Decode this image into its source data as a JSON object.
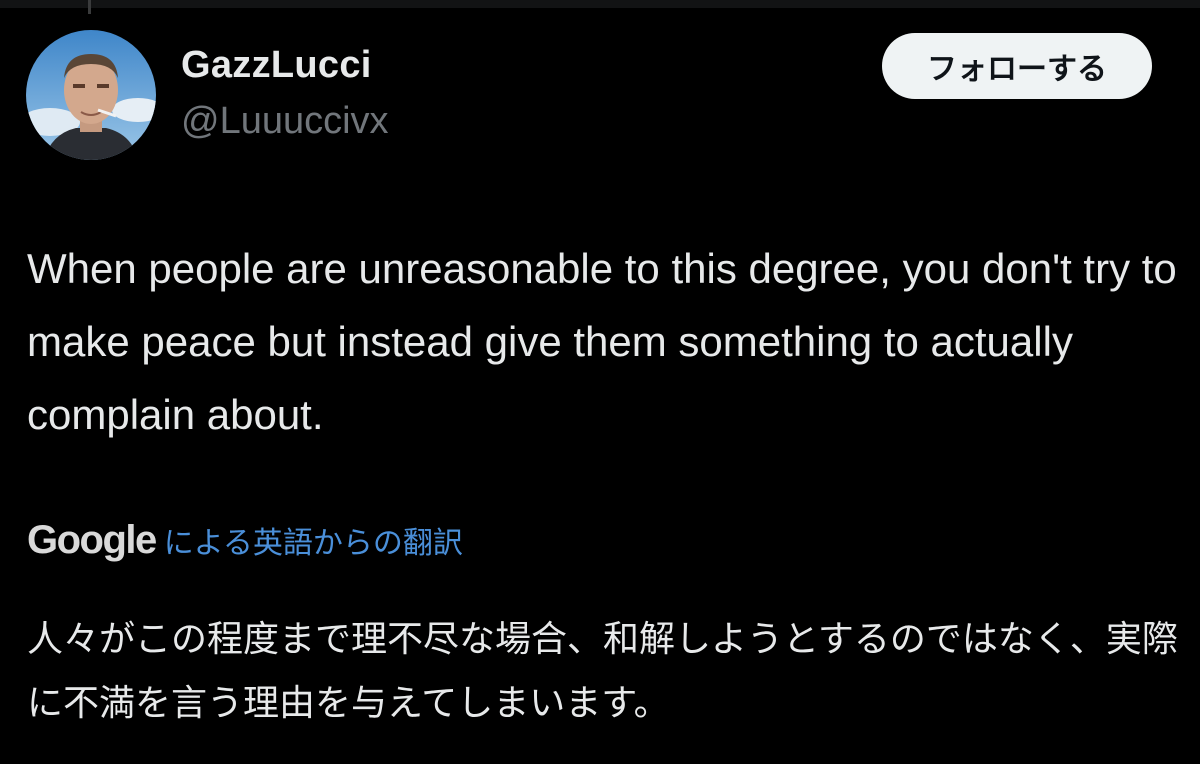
{
  "tweet": {
    "author": {
      "display_name": "GazzLucci",
      "handle": "@Luuuccivx"
    },
    "follow_label": "フォローする",
    "text": "When people are unreasonable to this degree, you don't try to make peace but instead give them something to actually complain about.",
    "translation": {
      "provider": "Google",
      "label": "による英語からの翻訳",
      "text": "人々がこの程度まで理不尽な場合、和解しようとするのではなく、実際に不満を言う理由を与えてしまいます。"
    }
  },
  "colors": {
    "background": "#000000",
    "text_primary": "#e7e9ea",
    "text_secondary": "#71767b",
    "link": "#4a8fd9",
    "button_bg": "#eff3f4",
    "button_text": "#0f1419"
  },
  "icons": {
    "avatar": "profile-photo"
  }
}
